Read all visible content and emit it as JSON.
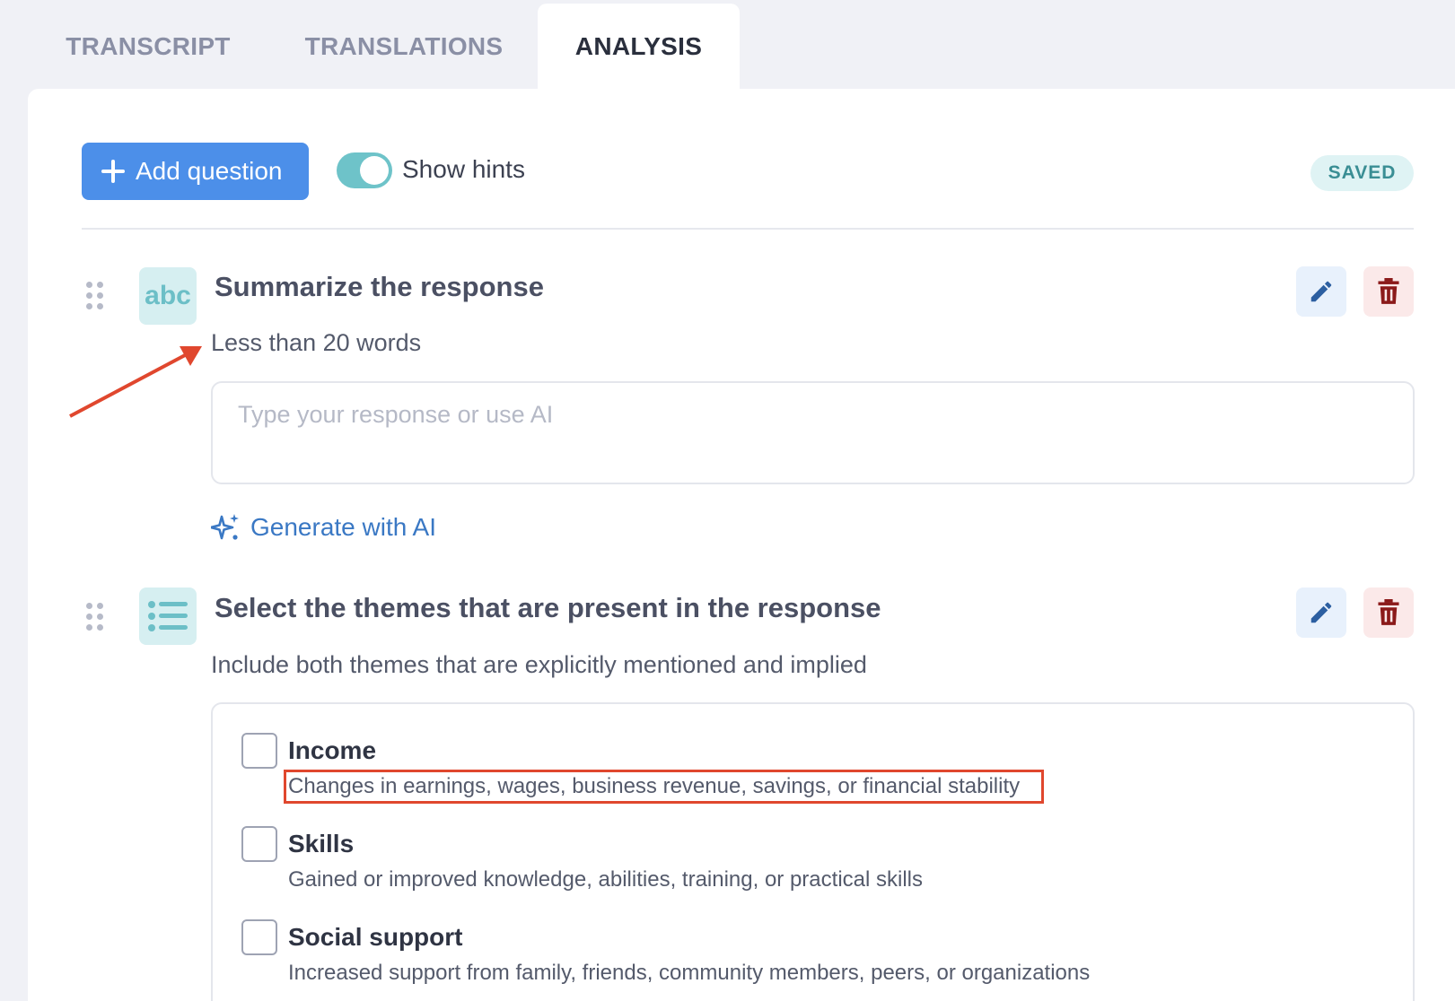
{
  "tabs": [
    {
      "label": "TRANSCRIPT",
      "active": false
    },
    {
      "label": "TRANSLATIONS",
      "active": false
    },
    {
      "label": "ANALYSIS",
      "active": true
    }
  ],
  "toolbar": {
    "add_question_label": "Add question",
    "show_hints_label": "Show hints",
    "show_hints_on": true,
    "status_badge": "SAVED"
  },
  "questions": [
    {
      "type_icon": "text-icon",
      "type_icon_text": "abc",
      "title": "Summarize the response",
      "hint": "Less than 20 words",
      "response_placeholder": "Type your response or use AI",
      "response_value": "",
      "generate_ai_label": "Generate with AI"
    },
    {
      "type_icon": "list-icon",
      "title": "Select the themes that are present in the response",
      "hint": "Include both themes that are explicitly mentioned and implied",
      "options": [
        {
          "name": "Income",
          "description": "Changes in earnings, wages, business revenue, savings, or financial stability",
          "checked": false,
          "highlighted": true
        },
        {
          "name": "Skills",
          "description": "Gained or improved knowledge, abilities, training, or practical skills",
          "checked": false,
          "highlighted": false
        },
        {
          "name": "Social support",
          "description": "Increased support from family, friends, community members, peers, or organizations",
          "checked": false,
          "highlighted": false
        }
      ]
    }
  ],
  "colors": {
    "accent_blue": "#4c8fe9",
    "toggle_teal": "#6ec3c9",
    "saved_text": "#3a8e94",
    "delete_red": "#8b1a1a",
    "annotation_red": "#e0472e"
  }
}
